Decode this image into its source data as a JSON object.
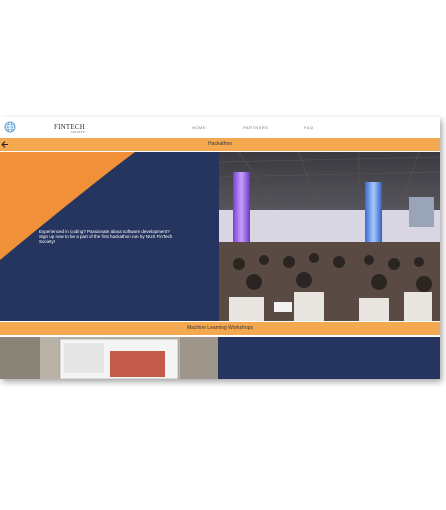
{
  "nav": {
    "brand": "FINTECH",
    "brand_sub": "SOCIETY",
    "links": [
      "HOME",
      "PARTNERS",
      "FAQ"
    ]
  },
  "sections": [
    {
      "title": "Hackathon",
      "description": "Experienced in coding? Passionate about software development? Sign up now to be a part of the first hackathon run by NUS FinTech Society!"
    },
    {
      "title": "Machine Learning Workshops"
    }
  ],
  "colors": {
    "accent": "#f4a850",
    "navy": "#263460",
    "orange": "#f0913a"
  }
}
